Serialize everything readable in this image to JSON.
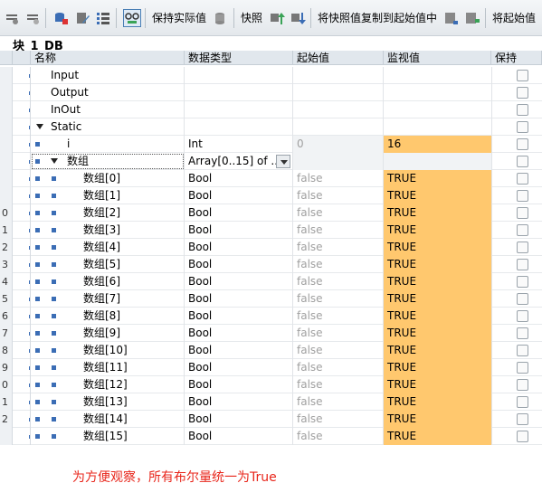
{
  "toolbar": {
    "keep_actual": "保持实际值",
    "snapshot": "快照",
    "copy_snapshot": "将快照值复制到起始值中",
    "load_start": "将起始值"
  },
  "block_title": "块_1_DB",
  "columns": {
    "name": "名称",
    "type": "数据类型",
    "start": "起始值",
    "monitor": "监视值",
    "retain": "保持"
  },
  "rows": [
    {
      "num": "",
      "name": "Input",
      "indent": 0,
      "type": "",
      "start": "",
      "monitor": ""
    },
    {
      "num": "",
      "name": "Output",
      "indent": 0,
      "type": "",
      "start": "",
      "monitor": ""
    },
    {
      "num": "",
      "name": "InOut",
      "indent": 0,
      "type": "",
      "start": "",
      "monitor": ""
    },
    {
      "num": "",
      "name": "Static",
      "indent": 0,
      "type": "",
      "start": "",
      "monitor": ""
    },
    {
      "num": "",
      "name": "i",
      "indent": 1,
      "type": "Int",
      "start": "0",
      "monitor": "16"
    },
    {
      "num": "",
      "name": "数组",
      "indent": 1,
      "type": "Array[0..15] of ...",
      "start": "",
      "monitor": ""
    },
    {
      "num": "",
      "name": "数组[0]",
      "indent": 2,
      "type": "Bool",
      "start": "false",
      "monitor": "TRUE"
    },
    {
      "num": "",
      "name": "数组[1]",
      "indent": 2,
      "type": "Bool",
      "start": "false",
      "monitor": "TRUE"
    },
    {
      "num": "0",
      "name": "数组[2]",
      "indent": 2,
      "type": "Bool",
      "start": "false",
      "monitor": "TRUE"
    },
    {
      "num": "1",
      "name": "数组[3]",
      "indent": 2,
      "type": "Bool",
      "start": "false",
      "monitor": "TRUE"
    },
    {
      "num": "2",
      "name": "数组[4]",
      "indent": 2,
      "type": "Bool",
      "start": "false",
      "monitor": "TRUE"
    },
    {
      "num": "3",
      "name": "数组[5]",
      "indent": 2,
      "type": "Bool",
      "start": "false",
      "monitor": "TRUE"
    },
    {
      "num": "4",
      "name": "数组[6]",
      "indent": 2,
      "type": "Bool",
      "start": "false",
      "monitor": "TRUE"
    },
    {
      "num": "5",
      "name": "数组[7]",
      "indent": 2,
      "type": "Bool",
      "start": "false",
      "monitor": "TRUE"
    },
    {
      "num": "6",
      "name": "数组[8]",
      "indent": 2,
      "type": "Bool",
      "start": "false",
      "monitor": "TRUE"
    },
    {
      "num": "7",
      "name": "数组[9]",
      "indent": 2,
      "type": "Bool",
      "start": "false",
      "monitor": "TRUE"
    },
    {
      "num": "8",
      "name": "数组[10]",
      "indent": 2,
      "type": "Bool",
      "start": "false",
      "monitor": "TRUE"
    },
    {
      "num": "9",
      "name": "数组[11]",
      "indent": 2,
      "type": "Bool",
      "start": "false",
      "monitor": "TRUE"
    },
    {
      "num": "0",
      "name": "数组[12]",
      "indent": 2,
      "type": "Bool",
      "start": "false",
      "monitor": "TRUE"
    },
    {
      "num": "1",
      "name": "数组[13]",
      "indent": 2,
      "type": "Bool",
      "start": "false",
      "monitor": "TRUE"
    },
    {
      "num": "2",
      "name": "数组[14]",
      "indent": 2,
      "type": "Bool",
      "start": "false",
      "monitor": "TRUE"
    },
    {
      "num": "",
      "name": "数组[15]",
      "indent": 2,
      "type": "Bool",
      "start": "false",
      "monitor": "TRUE"
    }
  ],
  "note": "为方便观察，所有布尔量统一为True",
  "colors": {
    "monitor_highlight": "#ffc86e",
    "note": "#e8261b"
  }
}
